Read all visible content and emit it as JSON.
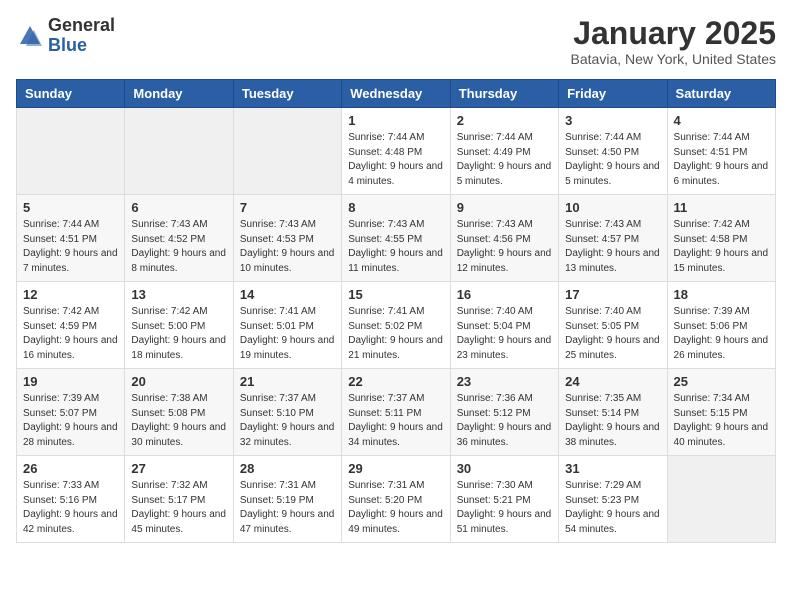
{
  "header": {
    "logo_general": "General",
    "logo_blue": "Blue",
    "month_title": "January 2025",
    "location": "Batavia, New York, United States"
  },
  "weekdays": [
    "Sunday",
    "Monday",
    "Tuesday",
    "Wednesday",
    "Thursday",
    "Friday",
    "Saturday"
  ],
  "weeks": [
    [
      {
        "day": "",
        "info": ""
      },
      {
        "day": "",
        "info": ""
      },
      {
        "day": "",
        "info": ""
      },
      {
        "day": "1",
        "info": "Sunrise: 7:44 AM\nSunset: 4:48 PM\nDaylight: 9 hours and 4 minutes."
      },
      {
        "day": "2",
        "info": "Sunrise: 7:44 AM\nSunset: 4:49 PM\nDaylight: 9 hours and 5 minutes."
      },
      {
        "day": "3",
        "info": "Sunrise: 7:44 AM\nSunset: 4:50 PM\nDaylight: 9 hours and 5 minutes."
      },
      {
        "day": "4",
        "info": "Sunrise: 7:44 AM\nSunset: 4:51 PM\nDaylight: 9 hours and 6 minutes."
      }
    ],
    [
      {
        "day": "5",
        "info": "Sunrise: 7:44 AM\nSunset: 4:51 PM\nDaylight: 9 hours and 7 minutes."
      },
      {
        "day": "6",
        "info": "Sunrise: 7:43 AM\nSunset: 4:52 PM\nDaylight: 9 hours and 8 minutes."
      },
      {
        "day": "7",
        "info": "Sunrise: 7:43 AM\nSunset: 4:53 PM\nDaylight: 9 hours and 10 minutes."
      },
      {
        "day": "8",
        "info": "Sunrise: 7:43 AM\nSunset: 4:55 PM\nDaylight: 9 hours and 11 minutes."
      },
      {
        "day": "9",
        "info": "Sunrise: 7:43 AM\nSunset: 4:56 PM\nDaylight: 9 hours and 12 minutes."
      },
      {
        "day": "10",
        "info": "Sunrise: 7:43 AM\nSunset: 4:57 PM\nDaylight: 9 hours and 13 minutes."
      },
      {
        "day": "11",
        "info": "Sunrise: 7:42 AM\nSunset: 4:58 PM\nDaylight: 9 hours and 15 minutes."
      }
    ],
    [
      {
        "day": "12",
        "info": "Sunrise: 7:42 AM\nSunset: 4:59 PM\nDaylight: 9 hours and 16 minutes."
      },
      {
        "day": "13",
        "info": "Sunrise: 7:42 AM\nSunset: 5:00 PM\nDaylight: 9 hours and 18 minutes."
      },
      {
        "day": "14",
        "info": "Sunrise: 7:41 AM\nSunset: 5:01 PM\nDaylight: 9 hours and 19 minutes."
      },
      {
        "day": "15",
        "info": "Sunrise: 7:41 AM\nSunset: 5:02 PM\nDaylight: 9 hours and 21 minutes."
      },
      {
        "day": "16",
        "info": "Sunrise: 7:40 AM\nSunset: 5:04 PM\nDaylight: 9 hours and 23 minutes."
      },
      {
        "day": "17",
        "info": "Sunrise: 7:40 AM\nSunset: 5:05 PM\nDaylight: 9 hours and 25 minutes."
      },
      {
        "day": "18",
        "info": "Sunrise: 7:39 AM\nSunset: 5:06 PM\nDaylight: 9 hours and 26 minutes."
      }
    ],
    [
      {
        "day": "19",
        "info": "Sunrise: 7:39 AM\nSunset: 5:07 PM\nDaylight: 9 hours and 28 minutes."
      },
      {
        "day": "20",
        "info": "Sunrise: 7:38 AM\nSunset: 5:08 PM\nDaylight: 9 hours and 30 minutes."
      },
      {
        "day": "21",
        "info": "Sunrise: 7:37 AM\nSunset: 5:10 PM\nDaylight: 9 hours and 32 minutes."
      },
      {
        "day": "22",
        "info": "Sunrise: 7:37 AM\nSunset: 5:11 PM\nDaylight: 9 hours and 34 minutes."
      },
      {
        "day": "23",
        "info": "Sunrise: 7:36 AM\nSunset: 5:12 PM\nDaylight: 9 hours and 36 minutes."
      },
      {
        "day": "24",
        "info": "Sunrise: 7:35 AM\nSunset: 5:14 PM\nDaylight: 9 hours and 38 minutes."
      },
      {
        "day": "25",
        "info": "Sunrise: 7:34 AM\nSunset: 5:15 PM\nDaylight: 9 hours and 40 minutes."
      }
    ],
    [
      {
        "day": "26",
        "info": "Sunrise: 7:33 AM\nSunset: 5:16 PM\nDaylight: 9 hours and 42 minutes."
      },
      {
        "day": "27",
        "info": "Sunrise: 7:32 AM\nSunset: 5:17 PM\nDaylight: 9 hours and 45 minutes."
      },
      {
        "day": "28",
        "info": "Sunrise: 7:31 AM\nSunset: 5:19 PM\nDaylight: 9 hours and 47 minutes."
      },
      {
        "day": "29",
        "info": "Sunrise: 7:31 AM\nSunset: 5:20 PM\nDaylight: 9 hours and 49 minutes."
      },
      {
        "day": "30",
        "info": "Sunrise: 7:30 AM\nSunset: 5:21 PM\nDaylight: 9 hours and 51 minutes."
      },
      {
        "day": "31",
        "info": "Sunrise: 7:29 AM\nSunset: 5:23 PM\nDaylight: 9 hours and 54 minutes."
      },
      {
        "day": "",
        "info": ""
      }
    ]
  ]
}
